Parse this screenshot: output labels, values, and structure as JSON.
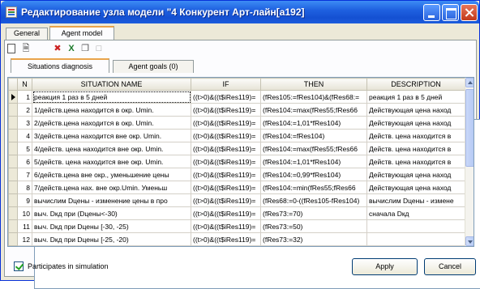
{
  "window": {
    "title": "Редактирование узла модели \"4 Конкурент Арт-лайн[а192]"
  },
  "tabs": [
    {
      "label": "General"
    },
    {
      "label": "Agent model"
    }
  ],
  "toolbar": {
    "icons": [
      "new-document-icon",
      "document-icon",
      "grid-icon",
      "delete-icon",
      "excel-icon",
      "copy-icon",
      "paste-icon"
    ]
  },
  "subtabs": [
    {
      "label": "Situations diagnosis"
    },
    {
      "label": "Agent goals (0)"
    }
  ],
  "grid": {
    "columns": [
      "N",
      "SITUATION NAME",
      "IF",
      "THEN",
      "DESCRIPTION"
    ],
    "rows": [
      {
        "n": "1",
        "name": "реакция 1 раз в 5 дней",
        "if": "((t>0)&((t$iRes119)=",
        "then": "(fRes105:=fRes104)&(fRes68:=",
        "desc": "реакция 1 раз в 5 дней"
      },
      {
        "n": "2",
        "name": "1/действ.цена находится в окр. Umin.",
        "if": "((t>0)&((t$iRes119)=",
        "then": "(fRes104:=max(fRes55;fRes66",
        "desc": "Действующая цена наход"
      },
      {
        "n": "3",
        "name": "2/действ.цена находится в окр. Umin.",
        "if": "((t>0)&((t$iRes119)=",
        "then": "(fRes104:=1,01*fRes104)",
        "desc": "Действующая цена наход"
      },
      {
        "n": "4",
        "name": "3/действ.цена находится вне окр. Umin.",
        "if": "((t>0)&((t$iRes119)=",
        "then": "(fRes104:=fRes104)",
        "desc": "Действ. цена находится в"
      },
      {
        "n": "5",
        "name": "4/действ. цена находится вне окр. Umin.",
        "if": "((t>0)&((t$iRes119)=",
        "then": "(fRes104:=max(fRes55;fRes66",
        "desc": "Действ. цена находится в"
      },
      {
        "n": "6",
        "name": "5/действ. цена находится вне окр. Umin.",
        "if": "((t>0)&((t$iRes119)=",
        "then": "(fRes104:=1,01*fRes104)",
        "desc": "Действ. цена находится в"
      },
      {
        "n": "7",
        "name": "6/действ.цена вне окр., уменьшение цены",
        "if": "((t>0)&((t$iRes119)=",
        "then": "(fRes104:=0,99*fRes104)",
        "desc": "Действующая цена наход"
      },
      {
        "n": "8",
        "name": "7/действ.цена нах. вне окр.Umin. Уменьш",
        "if": "((t>0)&((t$iRes119)=",
        "then": "(fRes104:=min(fRes55;fRes66",
        "desc": "Действующая цена наход"
      },
      {
        "n": "9",
        "name": "вычислим Dцены - изменение цены в про",
        "if": "((t>0)&((t$iRes119)=",
        "then": "(fRes68:=0-((fRes105-fRes104)",
        "desc": "вычислим Dцены - измене"
      },
      {
        "n": "10",
        "name": "выч. Dкд при (Dцены<-30)",
        "if": "((t>0)&((t$iRes119)=",
        "then": "(fRes73:=70)",
        "desc": "сначала Dкд"
      },
      {
        "n": "11",
        "name": "выч. Dкд при Dцены [-30, -25)",
        "if": "((t>0)&((t$iRes119)=",
        "then": "(fRes73:=50)",
        "desc": ""
      },
      {
        "n": "12",
        "name": "выч. Dкд при Dцены [-25, -20)",
        "if": "((t>0)&((t$iRes119)=",
        "then": "(fRes73:=32)",
        "desc": ""
      }
    ]
  },
  "footer": {
    "participates_label": "Participates in simulation",
    "participates_checked": true,
    "apply_label": "Apply",
    "cancel_label": "Cancel"
  }
}
